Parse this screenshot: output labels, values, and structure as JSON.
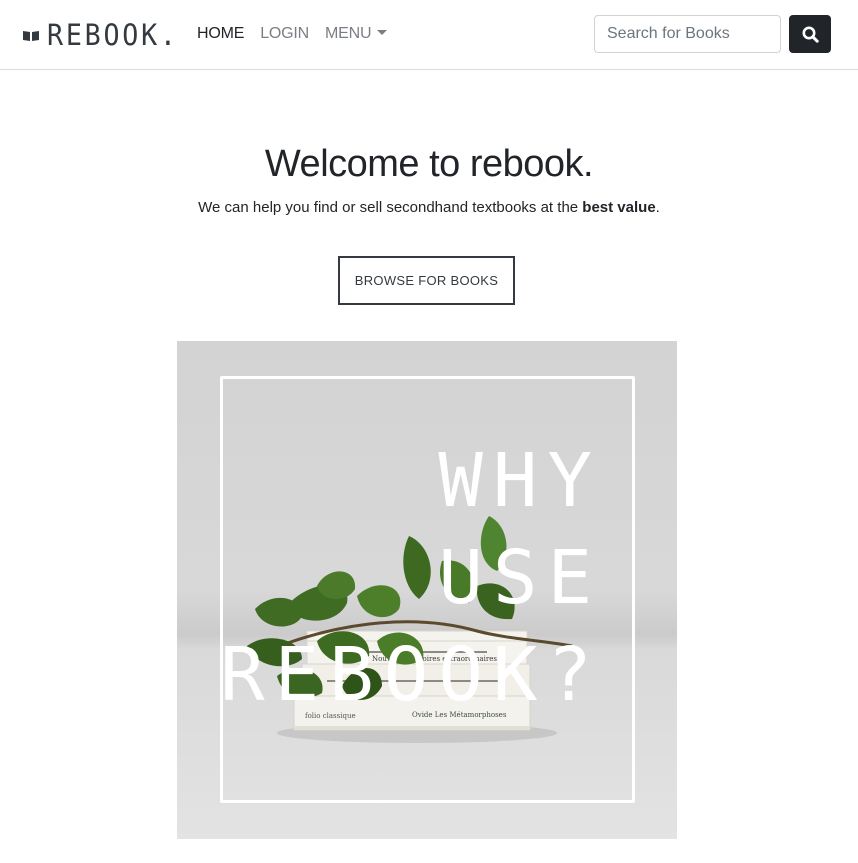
{
  "navbar": {
    "brand": "REBOOK.",
    "links": [
      {
        "label": "HOME",
        "active": true
      },
      {
        "label": "LOGIN",
        "active": false
      },
      {
        "label": "MENU",
        "active": false
      }
    ],
    "search_placeholder": "Search for Books",
    "search_icon": "search-icon"
  },
  "hero": {
    "title": "Welcome to rebook.",
    "subtitle_prefix": "We can help you find or sell secondhand textbooks at the ",
    "subtitle_bold": "best value",
    "subtitle_suffix": ".",
    "button_label": "BROWSE FOR BOOKS"
  },
  "banner": {
    "line1": "WHY",
    "line2": "USE",
    "line3": "REBOOK?",
    "book_titles": [
      "Nouvelles histoires extraordinaires",
      "Ovide   Les Métamorphoses"
    ],
    "book_publisher": "folio classique"
  },
  "colors": {
    "dark": "#212529",
    "muted": "#7a7f85",
    "border": "#dcdcdc"
  }
}
